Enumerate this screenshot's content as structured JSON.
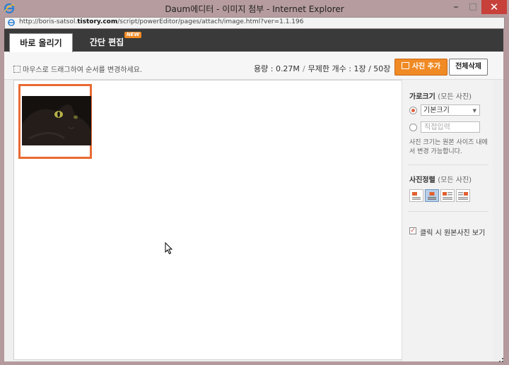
{
  "window": {
    "title": "Daum에디터 - 이미지 첨부 - Internet Explorer",
    "minimize": "–",
    "maximize": "□",
    "close": "✕"
  },
  "address": {
    "prefix": "http://boris-satsol.",
    "domain": "tistory.com",
    "path": "/script/powerEditor/pages/attach/image.html?ver=1.1.196"
  },
  "tabs": [
    {
      "label": "바로 올리기",
      "active": true
    },
    {
      "label": "간단 편집",
      "active": false,
      "badge": "NEW"
    }
  ],
  "toolbar": {
    "hint": "마우스로 드래그하여 순서를 변경하세요.",
    "usage_label": "용량 : 0.27M",
    "count_label": "무제한 개수 : 1장 / 50장",
    "add_button": "사진 추가",
    "delete_all_button": "전체삭제"
  },
  "sidebar": {
    "size": {
      "title": "가로크기",
      "title_sub": "(모든 사진)",
      "option_default": "기본크기",
      "option_custom_placeholder": "직접입력",
      "note": "사진 크기는 원본 사이즈 내에서 변경 가능합니다."
    },
    "align": {
      "title": "사진정렬",
      "title_sub": "(모든 사진)",
      "options": [
        "align-left",
        "align-center",
        "align-text-left",
        "align-text-right"
      ],
      "selected": 1
    },
    "click_original": {
      "label": "클릭 시 원본사진 보기",
      "checked": true
    }
  },
  "colors": {
    "accent": "#f08a24",
    "thumb_border": "#e86a33"
  }
}
